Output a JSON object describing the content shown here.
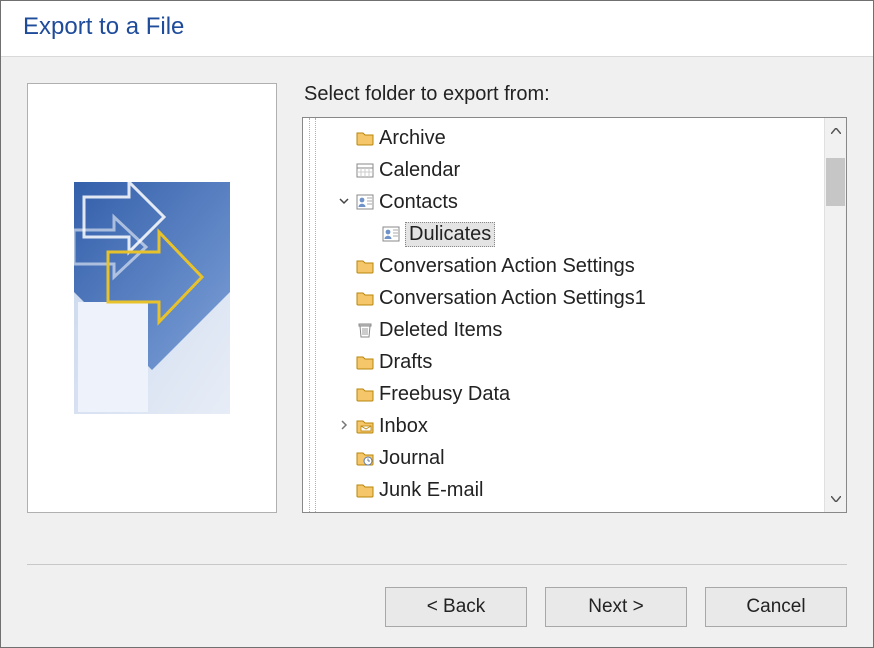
{
  "title": "Export to a File",
  "prompt": "Select folder to export from:",
  "tree": {
    "items": [
      {
        "icon": "folder-icon",
        "label": "Archive",
        "expander": "",
        "indent": 1,
        "selected": false
      },
      {
        "icon": "calendar-icon",
        "label": "Calendar",
        "expander": "",
        "indent": 1,
        "selected": false
      },
      {
        "icon": "contacts-icon",
        "label": "Contacts",
        "expander": "v",
        "indent": 1,
        "selected": false
      },
      {
        "icon": "contacts-icon",
        "label": "Dulicates",
        "expander": "",
        "indent": 2,
        "selected": true
      },
      {
        "icon": "folder-icon",
        "label": "Conversation Action Settings",
        "expander": "",
        "indent": 1,
        "selected": false
      },
      {
        "icon": "folder-icon",
        "label": "Conversation Action Settings1",
        "expander": "",
        "indent": 1,
        "selected": false
      },
      {
        "icon": "deleted-icon",
        "label": "Deleted Items",
        "expander": "",
        "indent": 1,
        "selected": false
      },
      {
        "icon": "folder-icon",
        "label": "Drafts",
        "expander": "",
        "indent": 1,
        "selected": false
      },
      {
        "icon": "folder-icon",
        "label": "Freebusy Data",
        "expander": "",
        "indent": 1,
        "selected": false
      },
      {
        "icon": "inbox-icon",
        "label": "Inbox",
        "expander": ">",
        "indent": 1,
        "selected": false
      },
      {
        "icon": "journal-icon",
        "label": "Journal",
        "expander": "",
        "indent": 1,
        "selected": false
      },
      {
        "icon": "folder-icon",
        "label": "Junk E-mail",
        "expander": "",
        "indent": 1,
        "selected": false
      }
    ]
  },
  "buttons": {
    "back": "< Back",
    "next": "Next >",
    "cancel": "Cancel"
  }
}
